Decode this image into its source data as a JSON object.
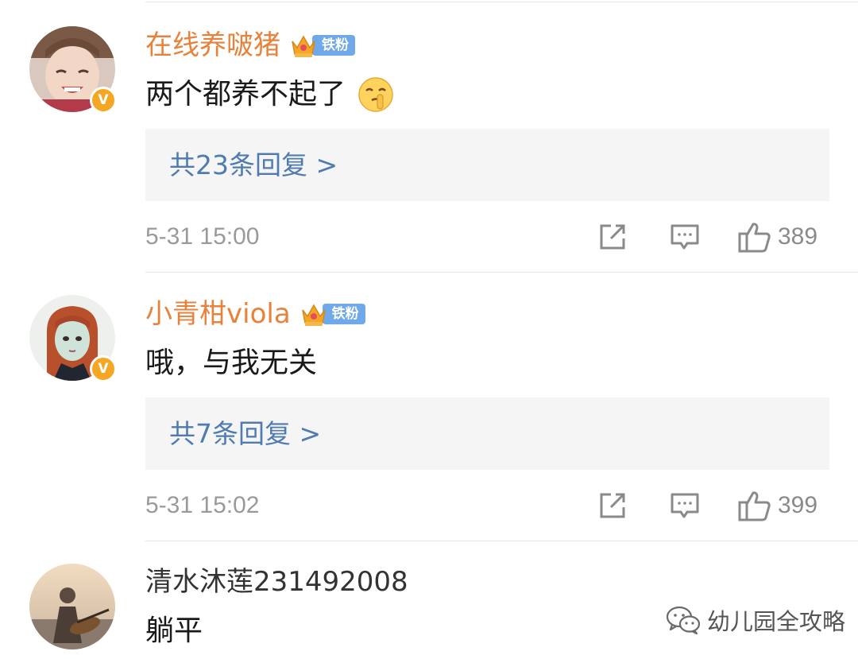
{
  "comments": [
    {
      "username": "在线养啵猪",
      "verified_badge": "V",
      "fan_badge": "铁粉",
      "text": "两个都养不起了",
      "emoji": "shushing-face-emoji",
      "replies_label": "共23条回复 >",
      "timestamp": "5-31 15:00",
      "likes": "389"
    },
    {
      "username": "小青柑viola",
      "verified_badge": "V",
      "fan_badge": "铁粉",
      "text": "哦，与我无关",
      "replies_label": "共7条回复 >",
      "timestamp": "5-31 15:02",
      "likes": "399"
    },
    {
      "username": "清水沐莲231492008",
      "text": "躺平"
    }
  ],
  "watermark": {
    "text": "幼儿园全攻略",
    "icon": "wechat-icon"
  },
  "colors": {
    "username_accent": "#e8823b",
    "reply_link": "#4f7bb0",
    "fan_badge": "#6fa9ea",
    "verified_badge": "#f5a623",
    "reply_box_bg": "#f5f5f5"
  }
}
